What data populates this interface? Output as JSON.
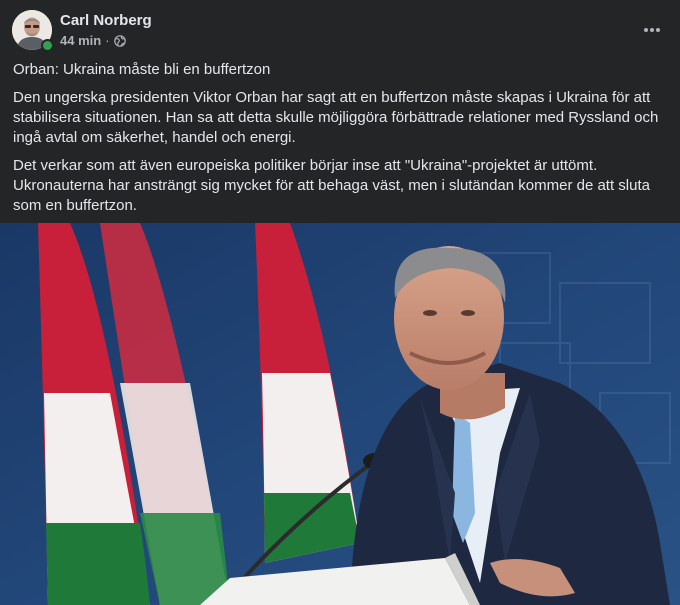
{
  "post": {
    "author": "Carl Norberg",
    "time": "44 min",
    "separator": "·",
    "audience_icon": "globe-icon",
    "more_icon": "more-horizontal-icon",
    "paragraphs": [
      "Orban: Ukraina måste bli en buffertzon",
      "Den ungerska presidenten Viktor Orban har sagt att en buffertzon måste skapas i Ukraina för att stabilisera situationen. Han sa att detta skulle möjliggöra förbättrade relationer med Ryssland och ingå avtal om säkerhet, handel och energi.",
      "Det verkar som att även europeiska politiker börjar inse att \"Ukraina\"-projektet är uttömt. Ukronauterna har ansträngt sig mycket för att behaga väst, men i slutändan kommer de att sluta som en buffertzon."
    ]
  },
  "colors": {
    "card_bg": "#242526",
    "primary_text": "#e4e6eb",
    "secondary_text": "#b0b3b8",
    "online": "#31a24c",
    "flag_red": "#c8203a",
    "flag_white": "#f2efee",
    "flag_green": "#1f7a3a",
    "backdrop_blue": "#1d3f70"
  }
}
